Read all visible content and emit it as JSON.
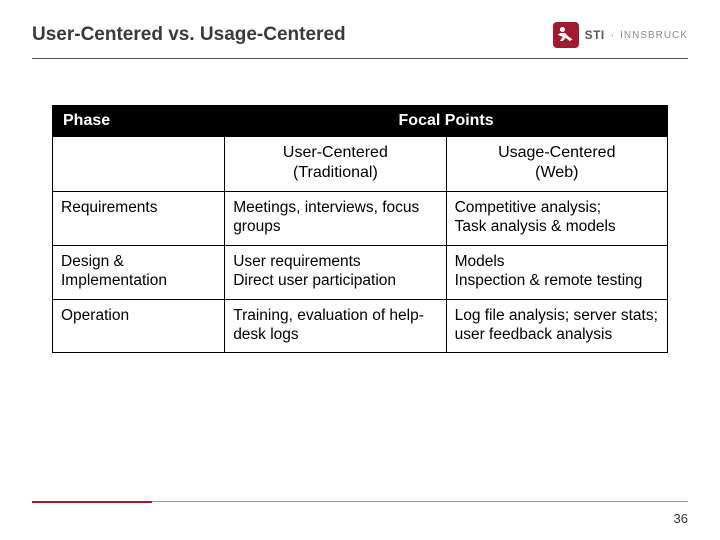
{
  "header": {
    "title": "User-Centered vs. Usage-Centered",
    "logo": {
      "abbr": "STI",
      "org": "INNSBRUCK"
    }
  },
  "table": {
    "head": {
      "phase": "Phase",
      "focal": "Focal Points"
    },
    "sub": {
      "user": {
        "l1": "User-Centered",
        "l2": "(Traditional)"
      },
      "usage": {
        "l1": "Usage-Centered",
        "l2": "(Web)"
      }
    },
    "rows": [
      {
        "phase": "Requirements",
        "user": "Meetings, interviews, focus groups",
        "usage": [
          "Competitive analysis;",
          "Task analysis & models"
        ]
      },
      {
        "phase": "Design & Implementation",
        "user": [
          "User requirements",
          "Direct user participation"
        ],
        "usage": [
          "Models",
          "Inspection & remote testing"
        ]
      },
      {
        "phase": "Operation",
        "user": "Training, evaluation of help-desk logs",
        "usage": "Log file analysis; server stats; user feedback analysis"
      }
    ]
  },
  "footer": {
    "page": "36"
  }
}
